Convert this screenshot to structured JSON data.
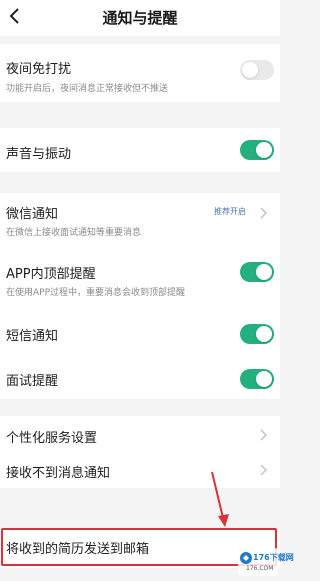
{
  "header": {
    "title": "通知与提醒"
  },
  "settings": {
    "night_dnd": {
      "label": "夜间免打扰",
      "description": "功能开启后，夜间消息正常接收但不推送",
      "toggle": "off"
    },
    "sound_vibration": {
      "label": "声音与振动",
      "toggle": "on"
    },
    "wechat_notify": {
      "label": "微信通知",
      "description": "在微信上接收面试通知等重要消息",
      "badge": "推荐开启"
    },
    "in_app_banner": {
      "label": "APP内顶部提醒",
      "description": "在使用APP过程中，重要消息会收到顶部提醒",
      "toggle": "on"
    },
    "sms_notify": {
      "label": "短信通知",
      "toggle": "on"
    },
    "interview_reminder": {
      "label": "面试提醒",
      "toggle": "on"
    },
    "personalized_service": {
      "label": "个性化服务设置"
    },
    "no_messages": {
      "label": "接收不到消息通知"
    },
    "resume_to_email": {
      "label": "将收到的简历发送到邮箱"
    }
  },
  "watermark": {
    "brand": "176下载网",
    "sub": "176.COM"
  },
  "colors": {
    "accent": "#23b07e",
    "toggle_off": "#e9e9e9",
    "annotation": "#d9323a",
    "badge_text": "#4b78a8"
  }
}
